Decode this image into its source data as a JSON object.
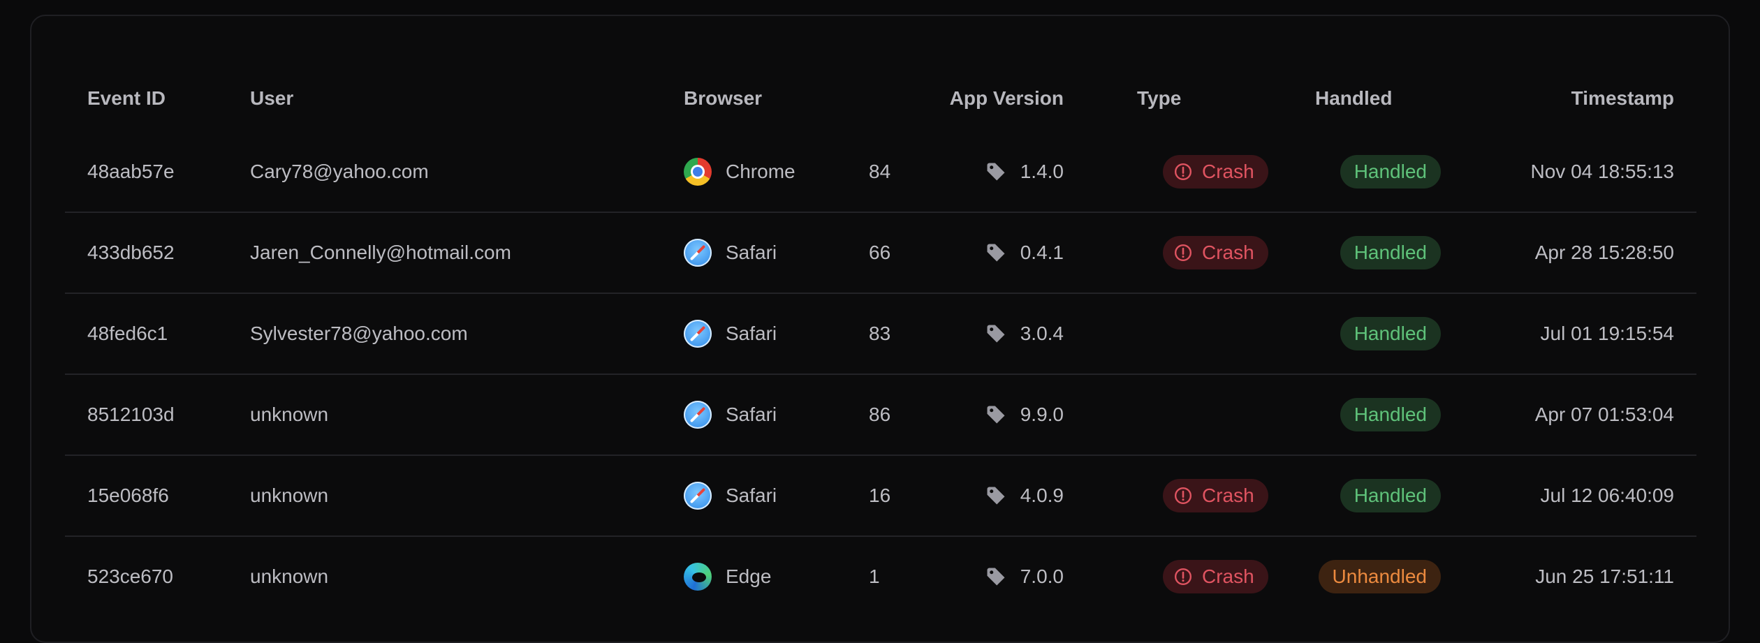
{
  "table": {
    "headers": {
      "event_id": "Event ID",
      "user": "User",
      "browser": "Browser",
      "app_version": "App Version",
      "type": "Type",
      "handled": "Handled",
      "timestamp": "Timestamp"
    },
    "rows": [
      {
        "event_id": "48aab57e",
        "user": "Cary78@yahoo.com",
        "browser": "Chrome",
        "browser_icon": "chrome-icon",
        "browser_version": "84",
        "app_version": "1.4.0",
        "type": "Crash",
        "handled": "Handled",
        "timestamp": "Nov 04 18:55:13"
      },
      {
        "event_id": "433db652",
        "user": "Jaren_Connelly@hotmail.com",
        "browser": "Safari",
        "browser_icon": "safari-icon",
        "browser_version": "66",
        "app_version": "0.4.1",
        "type": "Crash",
        "handled": "Handled",
        "timestamp": "Apr 28 15:28:50"
      },
      {
        "event_id": "48fed6c1",
        "user": "Sylvester78@yahoo.com",
        "browser": "Safari",
        "browser_icon": "safari-icon",
        "browser_version": "83",
        "app_version": "3.0.4",
        "type": "",
        "handled": "Handled",
        "timestamp": "Jul 01 19:15:54"
      },
      {
        "event_id": "8512103d",
        "user": "unknown",
        "browser": "Safari",
        "browser_icon": "safari-icon",
        "browser_version": "86",
        "app_version": "9.9.0",
        "type": "",
        "handled": "Handled",
        "timestamp": "Apr 07 01:53:04"
      },
      {
        "event_id": "15e068f6",
        "user": "unknown",
        "browser": "Safari",
        "browser_icon": "safari-icon",
        "browser_version": "16",
        "app_version": "4.0.9",
        "type": "Crash",
        "handled": "Handled",
        "timestamp": "Jul 12 06:40:09"
      },
      {
        "event_id": "523ce670",
        "user": "unknown",
        "browser": "Edge",
        "browser_icon": "edge-icon",
        "browser_version": "1",
        "app_version": "7.0.0",
        "type": "Crash",
        "handled": "Unhandled",
        "timestamp": "Jun 25 17:51:11"
      }
    ]
  },
  "colors": {
    "background": "#0a0a0b",
    "crash_bg": "#3a1418",
    "crash_text": "#e05461",
    "handled_bg": "#1b3321",
    "handled_text": "#5fc27a",
    "unhandled_bg": "#3d2311",
    "unhandled_text": "#ec8a3f"
  }
}
